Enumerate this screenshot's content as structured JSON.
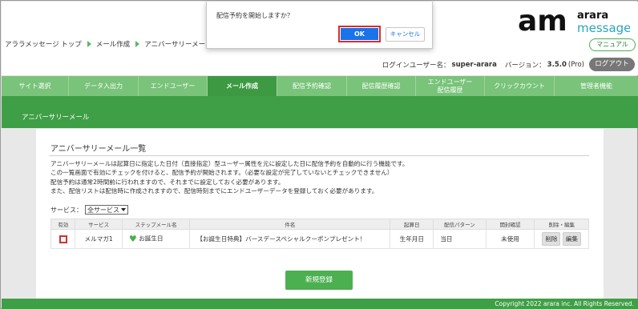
{
  "dialog": {
    "message": "配信予約を開始しますか？",
    "ok_label": "OK",
    "cancel_label": "キャンセル"
  },
  "logo": {
    "mark": "am",
    "word1": "arara",
    "word2": "message"
  },
  "breadcrumb": [
    "アララメッセージ トップ",
    "メール作成",
    "アニバーサリーメール"
  ],
  "header": {
    "manual_label": "マニュアル",
    "login_label": "ログインユーザー名：",
    "login_user": "super-arara",
    "version_label": "バージョン：",
    "version_value": "3.5.0",
    "version_suffix": "(Pro)",
    "logout_label": "ログアウト"
  },
  "nav": [
    "サイト選択",
    "データ入出力",
    "エンドユーザー",
    "メール作成",
    "配信予約確認",
    "配信履歴確認",
    "エンドユーザー\n配信履歴",
    "クリックカウント",
    "管理者機能"
  ],
  "section_title": "アニバーサリーメール",
  "panel": {
    "title": "アニバーサリーメール一覧",
    "desc": [
      "アニバーサリーメールは起算日に指定した日付（直接指定）型ユーザー属性を元に設定した日に配信予約を自動的に行う機能です。",
      "この一覧画面で有効にチェックを付けると、配信予約が開始されます。（必要な設定が完了していないとチェックできません）",
      "配信予約は通常2時間前に行われますので、それまでに設定しておく必要があります。",
      "また、配信リストは配信時に作成されますので、配信時刻までにエンドユーザーデータを登録しておく必要があります。"
    ],
    "service_label": "サービス：",
    "service_value": "全サービス",
    "register_label": "新規登録"
  },
  "table": {
    "headers": [
      "有効",
      "サービス",
      "ステップメール名",
      "件名",
      "起算日",
      "配信パターン",
      "開封確認",
      "削除・編集"
    ],
    "rows": [
      {
        "service": "メルマガ1",
        "step_name": "お誕生日",
        "subject": "【お誕生日特典】バースデースペシャルクーポンプレゼント！",
        "base_date": "生年月日",
        "pattern": "当日",
        "open_check": "未使用",
        "delete": "削除",
        "edit": "編集"
      }
    ]
  },
  "footer": "Copyright 2022 arara inc. All Rights Reserved.",
  "colors": {
    "accent_green": "#3f9f46",
    "nav_green": "#79c37a",
    "ok_blue": "#1a73e8",
    "highlight_red": "#d32f2f"
  }
}
